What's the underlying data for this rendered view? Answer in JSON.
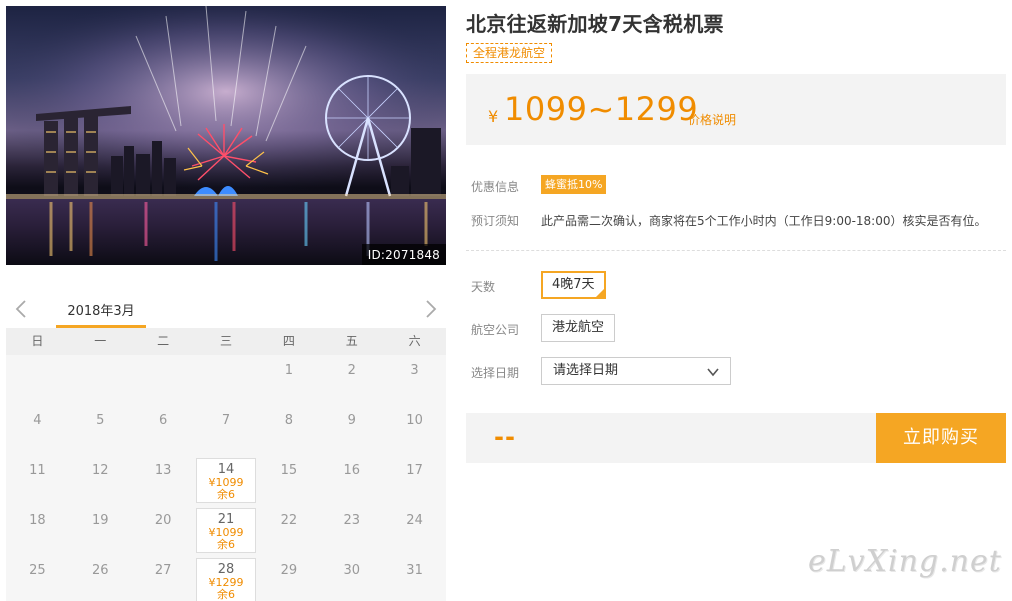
{
  "product": {
    "title": "北京往返新加坡7天含税机票",
    "tag": "全程港龙航空",
    "photo_id": "ID:2071848"
  },
  "price": {
    "currency_symbol": "¥",
    "range": "1099~1299",
    "note_link": "价格说明"
  },
  "info": {
    "promo_label": "优惠信息",
    "promo_badge": "蜂蜜抵10%",
    "notice_label": "预订须知",
    "notice_text": "此产品需二次确认，商家将在5个工作小时内（工作日9:00-18:00）核实是否有位。"
  },
  "options": {
    "days_label": "天数",
    "days_value": "4晚7天",
    "airline_label": "航空公司",
    "airline_value": "港龙航空",
    "date_label": "选择日期",
    "date_placeholder": "请选择日期"
  },
  "buy": {
    "total": "--",
    "button": "立即购买"
  },
  "calendar": {
    "month": "2018年3月",
    "weekdays": [
      "日",
      "一",
      "二",
      "三",
      "四",
      "五",
      "六"
    ],
    "cells": [
      {
        "d": ""
      },
      {
        "d": ""
      },
      {
        "d": ""
      },
      {
        "d": ""
      },
      {
        "d": "1"
      },
      {
        "d": "2"
      },
      {
        "d": "3"
      },
      {
        "d": "4"
      },
      {
        "d": "5"
      },
      {
        "d": "6"
      },
      {
        "d": "7"
      },
      {
        "d": "8"
      },
      {
        "d": "9"
      },
      {
        "d": "10"
      },
      {
        "d": "11"
      },
      {
        "d": "12"
      },
      {
        "d": "13"
      },
      {
        "d": "14",
        "price": "¥1099",
        "stock": "余6"
      },
      {
        "d": "15"
      },
      {
        "d": "16"
      },
      {
        "d": "17"
      },
      {
        "d": "18"
      },
      {
        "d": "19"
      },
      {
        "d": "20"
      },
      {
        "d": "21",
        "price": "¥1099",
        "stock": "余6"
      },
      {
        "d": "22"
      },
      {
        "d": "23"
      },
      {
        "d": "24"
      },
      {
        "d": "25"
      },
      {
        "d": "26"
      },
      {
        "d": "27"
      },
      {
        "d": "28",
        "price": "¥1299",
        "stock": "余6"
      },
      {
        "d": "29"
      },
      {
        "d": "30"
      },
      {
        "d": "31"
      }
    ]
  },
  "watermark": "eLvXing.net",
  "colors": {
    "accent": "#f5a623",
    "price": "#f08c00"
  }
}
